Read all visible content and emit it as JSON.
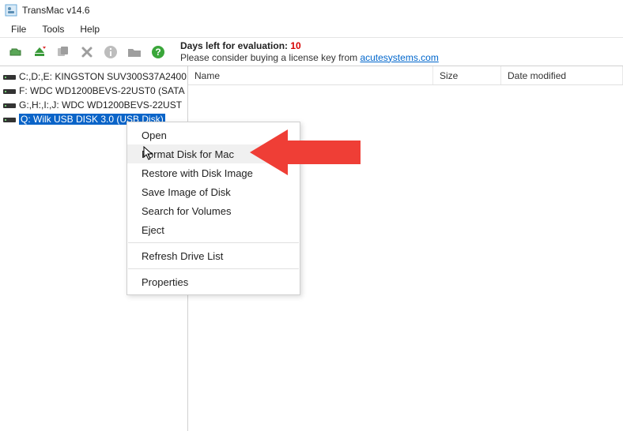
{
  "window": {
    "title": "TransMac v14.6"
  },
  "menu": {
    "file": "File",
    "tools": "Tools",
    "help": "Help"
  },
  "eval": {
    "line1_prefix": "Days left for evaluation: ",
    "days": "10",
    "line2_prefix": "Please consider buying a license key from ",
    "link": "acutesystems.com"
  },
  "tree": {
    "items": [
      {
        "label": "C:,D:,E:  KINGSTON SUV300S37A2400"
      },
      {
        "label": "F:  WDC WD1200BEVS-22UST0 (SATA"
      },
      {
        "label": "G:,H:,I:,J:  WDC WD1200BEVS-22UST"
      },
      {
        "label": "Q: Wilk USB DISK 3.0 (USB Disk)"
      }
    ]
  },
  "list_headers": {
    "name": "Name",
    "size": "Size",
    "date": "Date modified"
  },
  "context_menu": {
    "open": "Open",
    "format": "Format Disk for Mac",
    "restore": "Restore with Disk Image",
    "save": "Save Image of Disk",
    "search": "Search for Volumes",
    "eject": "Eject",
    "refresh": "Refresh Drive List",
    "properties": "Properties"
  }
}
